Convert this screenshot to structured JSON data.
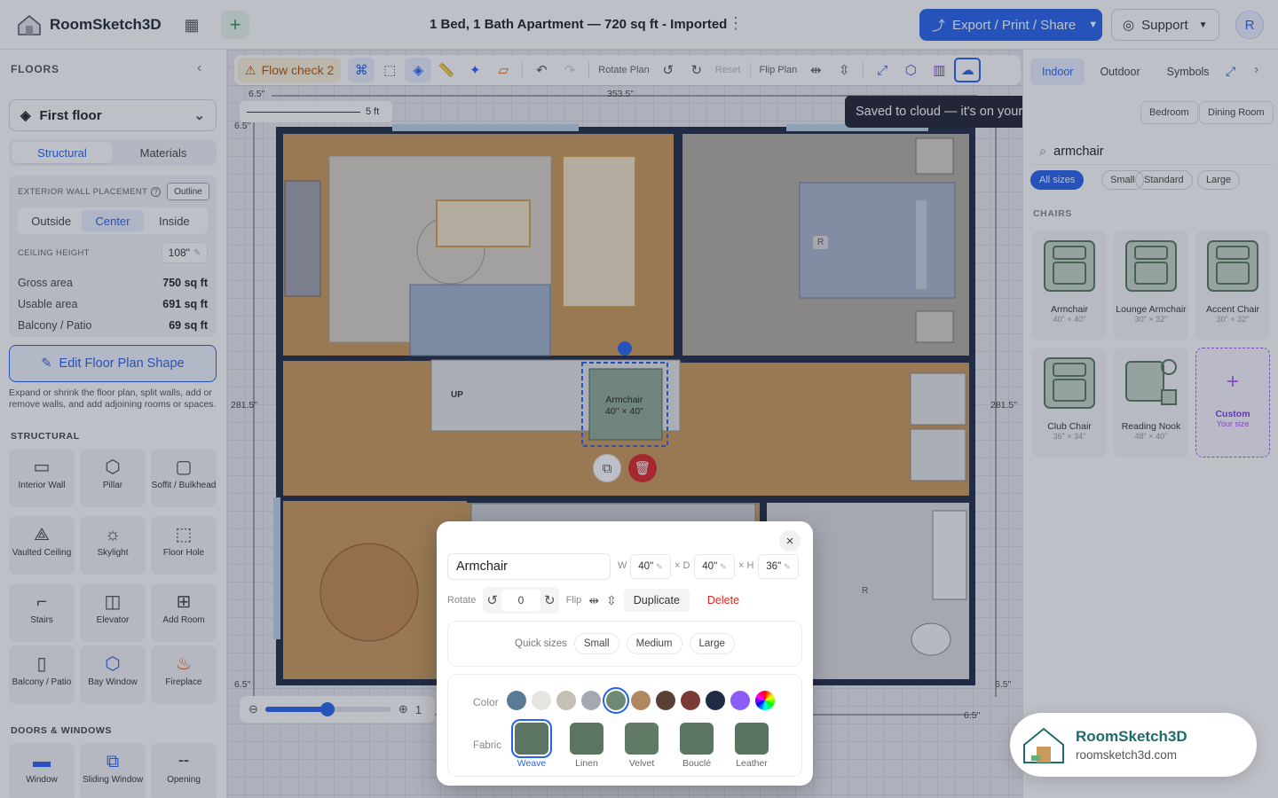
{
  "app": {
    "name": "RoomSketch3D",
    "doc_title": "1 Bed, 1 Bath Apartment — 720 sq ft - Imported"
  },
  "topbar": {
    "export_label": "Export / Print / Share",
    "support_label": "Support",
    "avatar_initial": "R"
  },
  "sidebar": {
    "floors_heading": "FLOORS",
    "floor_selected": "First floor",
    "tabs": [
      "Structural",
      "Materials"
    ],
    "wall_placement_label": "EXTERIOR WALL PLACEMENT",
    "outline_tag": "Outline",
    "placement_options": [
      "Outside",
      "Center",
      "Inside"
    ],
    "ceiling_label": "CEILING HEIGHT",
    "ceiling_value": "108\"",
    "stats": [
      {
        "label": "Gross area",
        "value": "750 sq ft"
      },
      {
        "label": "Usable area",
        "value": "691 sq ft"
      },
      {
        "label": "Balcony / Patio",
        "value": "69 sq ft"
      }
    ],
    "edit_button": "Edit Floor Plan Shape",
    "edit_help": "Expand or shrink the floor plan, split walls, add or remove walls, and add adjoining rooms or spaces.",
    "structural_heading": "STRUCTURAL",
    "structural_tools": [
      "Interior Wall",
      "Pillar",
      "Soffit / Bulkhead",
      "Vaulted Ceiling",
      "Skylight",
      "Floor Hole",
      "Stairs",
      "Elevator",
      "Add Room",
      "Balcony / Patio",
      "Bay Window",
      "Fireplace"
    ],
    "doors_heading": "DOORS & WINDOWS",
    "door_tools": [
      "Window",
      "Sliding Window",
      "Opening"
    ]
  },
  "toolbar": {
    "flow_check": "Flow check 2",
    "rotate_label": "Rotate Plan",
    "reset_label": "Reset",
    "flip_label": "Flip Plan"
  },
  "tooltip": "Saved to cloud — it's on your account now",
  "canvas": {
    "scale_label": "5 ft",
    "dims": [
      "6.5\"",
      "353.5\"",
      "6.5\"",
      "281.5\"",
      "281.5\"",
      "6.5\"",
      "6.5\"",
      "6.5\"",
      "6.5\"",
      "6.5\""
    ],
    "stairs_label": "UP",
    "selected_item": {
      "name": "Armchair",
      "size": "40\" × 40\""
    },
    "room_tag": "R",
    "zoom_value": "1"
  },
  "props": {
    "name": "Armchair",
    "w_label": "W",
    "w_value": "40\"",
    "d_label": "× D",
    "d_value": "40\"",
    "h_label": "× H",
    "h_value": "36\"",
    "rotate_label": "Rotate",
    "rotate_value": "0",
    "flip_label": "Flip",
    "duplicate_label": "Duplicate",
    "delete_label": "Delete",
    "quick_sizes_label": "Quick sizes",
    "quick_sizes": [
      "Small",
      "Medium",
      "Large"
    ],
    "color_label": "Color",
    "colors": [
      "#5b7a96",
      "#e5e5e2",
      "#c6bfb4",
      "#a3a8b3",
      "#6e8a74",
      "#b08860",
      "#5a4034",
      "#7a3a36",
      "#1f2a44",
      "#8b5cf6"
    ],
    "fabric_label": "Fabric",
    "fabrics": [
      "Weave",
      "Linen",
      "Velvet",
      "Bouclé",
      "Leather"
    ]
  },
  "rpanel": {
    "tabs": [
      "Indoor",
      "Outdoor",
      "Symbols"
    ],
    "categories": [
      "Bedroom",
      "Dining Room"
    ],
    "search_value": "armchair",
    "sizes": [
      "All sizes",
      "Small",
      "Standard",
      "Large"
    ],
    "section": "CHAIRS",
    "chairs": [
      {
        "name": "Armchair",
        "dims": "40\" × 40\""
      },
      {
        "name": "Lounge Armchair",
        "dims": "30\" × 32\""
      },
      {
        "name": "Accent Chair",
        "dims": "30\" × 32\""
      },
      {
        "name": "Club Chair",
        "dims": "36\" × 34\""
      },
      {
        "name": "Reading Nook",
        "dims": "48\" × 40\""
      },
      {
        "name": "Custom",
        "dims": "Your size"
      }
    ]
  },
  "badge": {
    "name": "RoomSketch3D",
    "url": "roomsketch3d.com"
  }
}
